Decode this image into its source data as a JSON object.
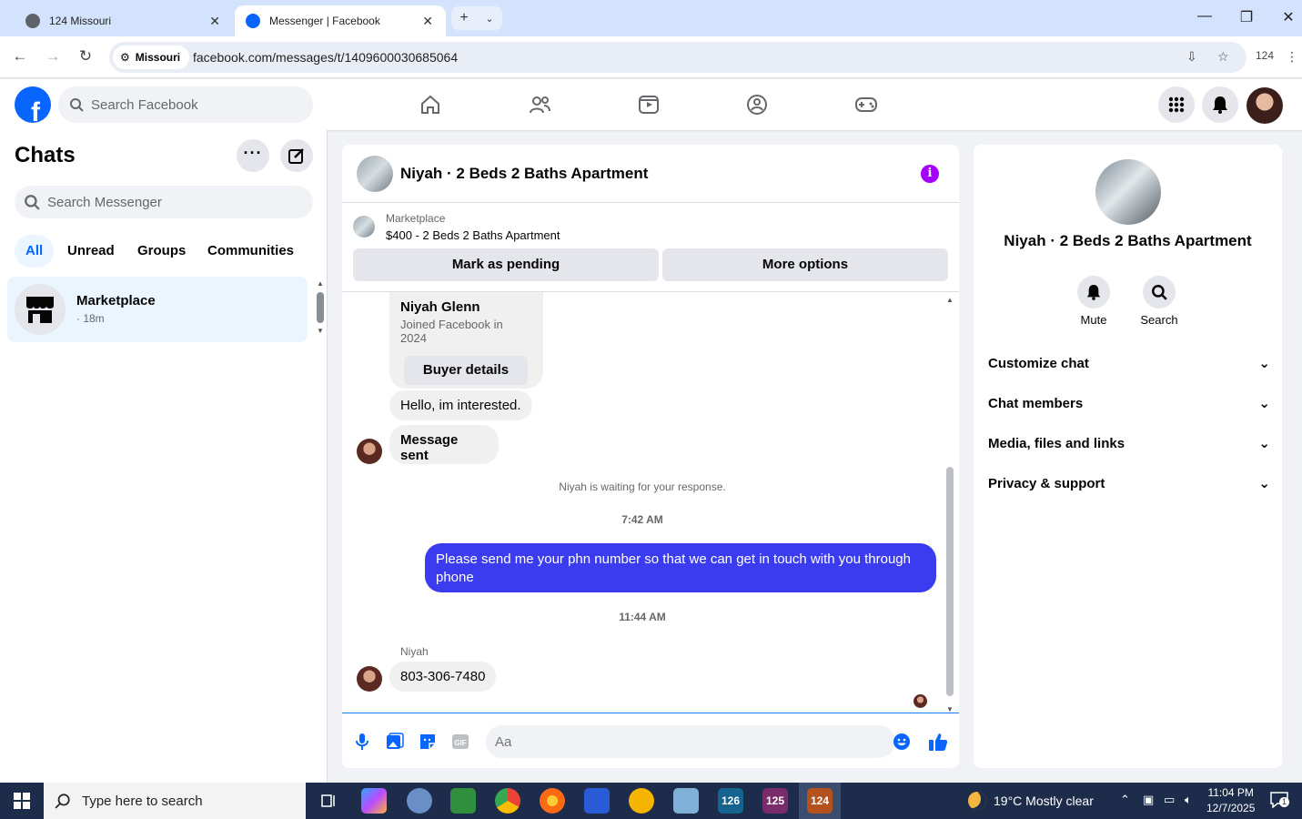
{
  "browser": {
    "tabs": [
      {
        "title": "124 Missouri"
      },
      {
        "title": "Messenger | Facebook"
      }
    ],
    "site_chip": "Missouri",
    "url": "facebook.com/messages/t/1409600030685064",
    "profile_badge": "124"
  },
  "header": {
    "logo": "f",
    "search_placeholder": "Search Facebook"
  },
  "sidebar": {
    "title": "Chats",
    "search_placeholder": "Search Messenger",
    "filters": [
      "All",
      "Unread",
      "Groups",
      "Communities"
    ],
    "conversation": {
      "name": "Marketplace",
      "time": "· 18m"
    }
  },
  "chat": {
    "title": "Niyah · 2 Beds 2 Baths Apartment",
    "listing": {
      "source": "Marketplace",
      "title": "$400 - 2 Beds 2 Baths Apartment",
      "btn_pending": "Mark as pending",
      "btn_more": "More options"
    },
    "buyer_card": {
      "name": "Niyah Glenn",
      "joined": "Joined Facebook in 2024",
      "button": "Buyer details"
    },
    "msg_interested": "Hello, im interested.",
    "msg_sent": "Message sent",
    "waiting": "Niyah is waiting for your response.",
    "time1": "7:42 AM",
    "outgoing": "Please send me your phn number so that we can get in touch with you through phone",
    "time2": "11:44 AM",
    "sender": "Niyah",
    "phone": "803-306-7480",
    "composer_placeholder": "Aa"
  },
  "details": {
    "title": "Niyah · 2 Beds 2 Baths Apartment",
    "actions": [
      "Mute",
      "Search"
    ],
    "sections": [
      "Customize chat",
      "Chat members",
      "Media, files and links",
      "Privacy & support"
    ]
  },
  "taskbar": {
    "search_placeholder": "Type here to search",
    "apps": [
      "126",
      "125",
      "124"
    ],
    "weather": "19°C  Mostly clear",
    "time": "11:04 PM",
    "date": "12/7/2025",
    "notification_count": "1"
  },
  "colors": {
    "fb_blue": "#0866ff",
    "outgoing_bubble": "#3b3cf0",
    "info_purple": "#a400ff"
  }
}
